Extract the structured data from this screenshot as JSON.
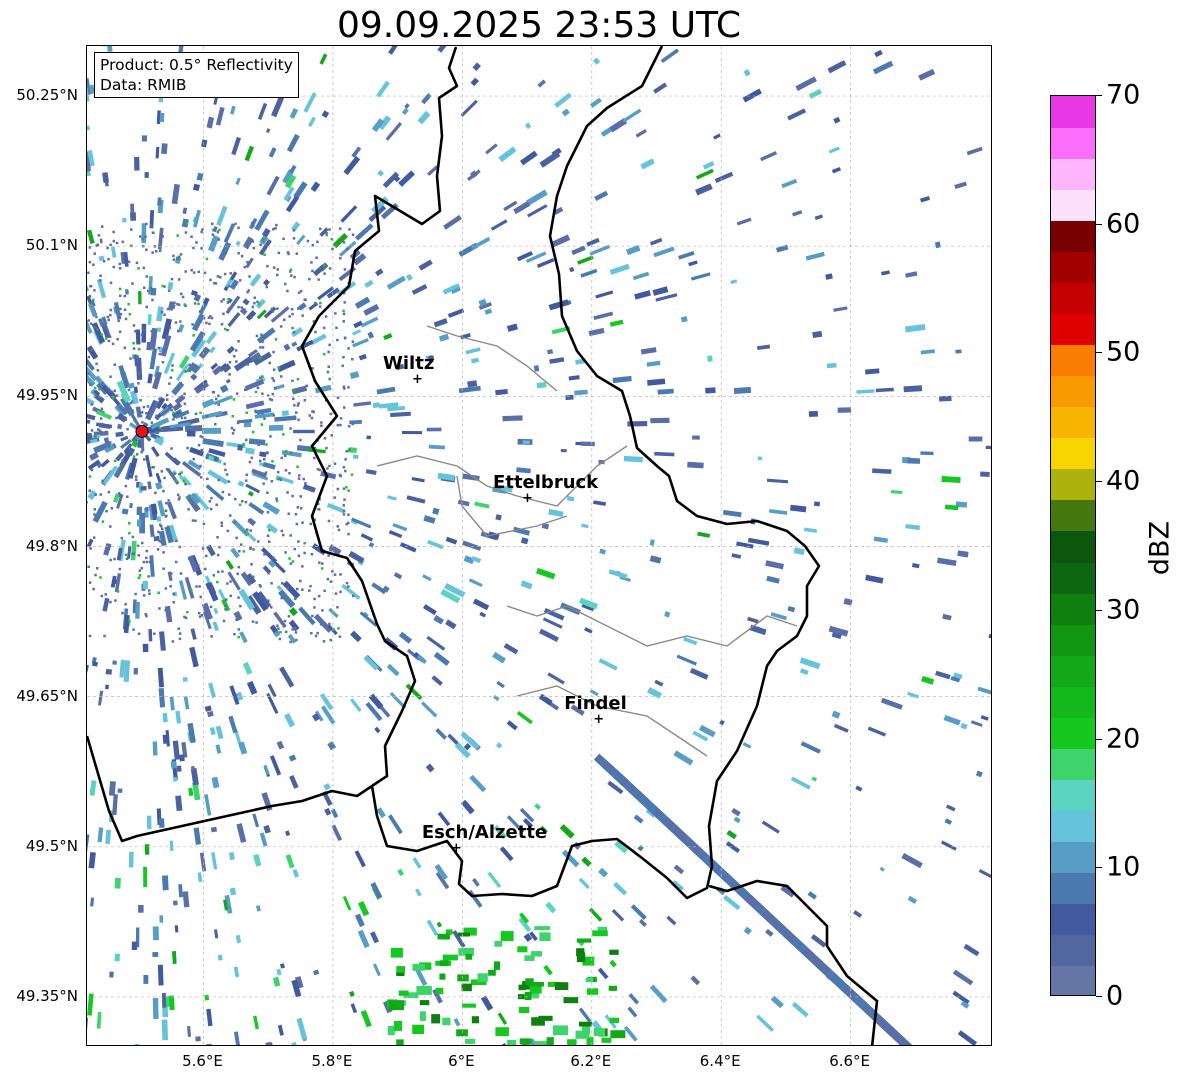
{
  "title": "09.09.2025 23:53 UTC",
  "info_box": {
    "product": "Product: 0.5° Reflectivity",
    "data_source": "Data: RMIB"
  },
  "axes": {
    "lon_range": [
      5.42,
      6.82
    ],
    "lat_range": [
      49.3,
      50.3
    ],
    "lat_ticks": [
      {
        "value": 50.25,
        "label": "50.25°N"
      },
      {
        "value": 50.1,
        "label": "50.1°N"
      },
      {
        "value": 49.95,
        "label": "49.95°N"
      },
      {
        "value": 49.8,
        "label": "49.8°N"
      },
      {
        "value": 49.65,
        "label": "49.65°N"
      },
      {
        "value": 49.5,
        "label": "49.5°N"
      },
      {
        "value": 49.35,
        "label": "49.35°N"
      }
    ],
    "lon_ticks": [
      {
        "value": 5.6,
        "label": "5.6°E"
      },
      {
        "value": 5.8,
        "label": "5.8°E"
      },
      {
        "value": 6.0,
        "label": "6°E"
      },
      {
        "value": 6.2,
        "label": "6.2°E"
      },
      {
        "value": 6.4,
        "label": "6.4°E"
      },
      {
        "value": 6.6,
        "label": "6.6°E"
      }
    ],
    "gridlines": true
  },
  "radar_site": {
    "lon": 5.505,
    "lat": 49.915,
    "color": "#e8101a"
  },
  "cities": [
    {
      "name": "Wiltz",
      "lon": 5.93,
      "lat": 49.966
    },
    {
      "name": "Ettelbruck",
      "lon": 6.1,
      "lat": 49.847
    },
    {
      "name": "Findel",
      "lon": 6.21,
      "lat": 49.627
    },
    {
      "name": "Esch/Alzette",
      "lon": 5.99,
      "lat": 49.498
    }
  ],
  "colorbar": {
    "label": "dBZ",
    "min": 0,
    "max": 70,
    "ticks": [
      {
        "value": 0,
        "label": "0"
      },
      {
        "value": 10,
        "label": "10"
      },
      {
        "value": 20,
        "label": "20"
      },
      {
        "value": 30,
        "label": "30"
      },
      {
        "value": 40,
        "label": "40"
      },
      {
        "value": 50,
        "label": "50"
      },
      {
        "value": 60,
        "label": "60"
      },
      {
        "value": 70,
        "label": "70"
      }
    ],
    "colors": [
      "#6475a6",
      "#5266a0",
      "#41599f",
      "#4a7aaf",
      "#579ec6",
      "#65c4dc",
      "#5ad4c0",
      "#3ed46c",
      "#14c820",
      "#12b81c",
      "#12a818",
      "#109612",
      "#0f7f10",
      "#0c6710",
      "#0a570d",
      "#467810",
      "#adb30d",
      "#f8d400",
      "#f8b500",
      "#f89a00",
      "#f87d00",
      "#e00000",
      "#c40000",
      "#a30000",
      "#7a0000",
      "#fde0fc",
      "#fdb6fc",
      "#fb6efa",
      "#e838e6"
    ]
  },
  "map_colors": {
    "border": "#000000",
    "district_border": "#888888",
    "grid": "#b8b8b8"
  }
}
